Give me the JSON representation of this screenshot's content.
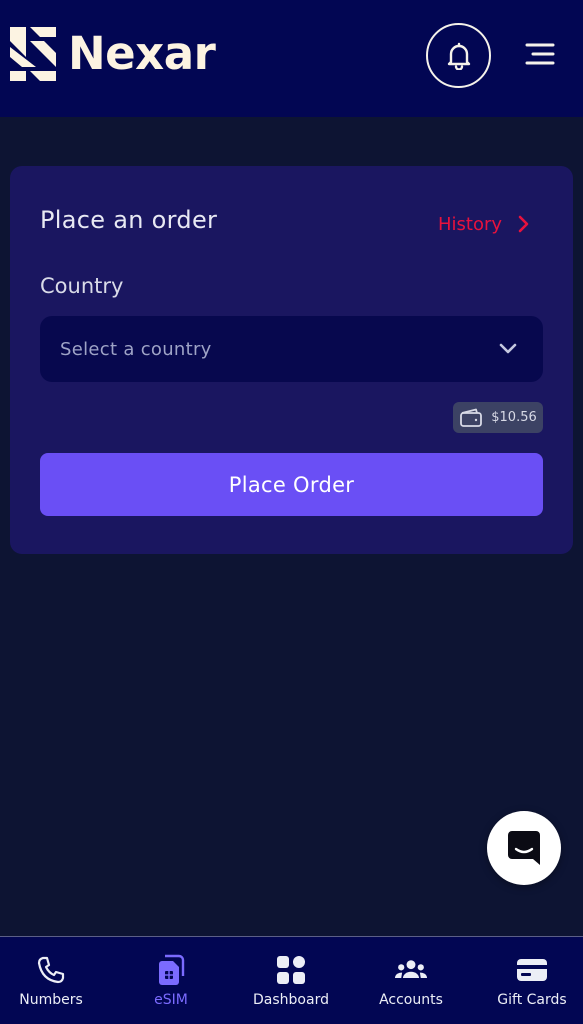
{
  "header": {
    "brand": "Nexar",
    "icons": {
      "logo": "nexar-logo-icon",
      "bell": "bell-icon",
      "menu": "hamburger-menu-icon"
    }
  },
  "order_card": {
    "title": "Place an order",
    "history_label": "History",
    "country_label": "Country",
    "country_placeholder": "Select a country",
    "balance": "$10.56",
    "place_order_label": "Place Order"
  },
  "bottom_nav": {
    "items": [
      {
        "label": "Numbers",
        "icon": "phone-icon",
        "active": false
      },
      {
        "label": "eSIM",
        "icon": "esim-card-icon",
        "active": true
      },
      {
        "label": "Dashboard",
        "icon": "dashboard-grid-icon",
        "active": false
      },
      {
        "label": "Accounts",
        "icon": "users-icon",
        "active": false
      },
      {
        "label": "Gift Cards",
        "icon": "gift-card-icon",
        "active": false
      }
    ]
  },
  "colors": {
    "background": "#0d1433",
    "header_bg": "#020653",
    "card_bg": "#1a1660",
    "accent": "#6a4ff5",
    "active_nav": "#7b6bff",
    "history_red": "#e8123d"
  }
}
